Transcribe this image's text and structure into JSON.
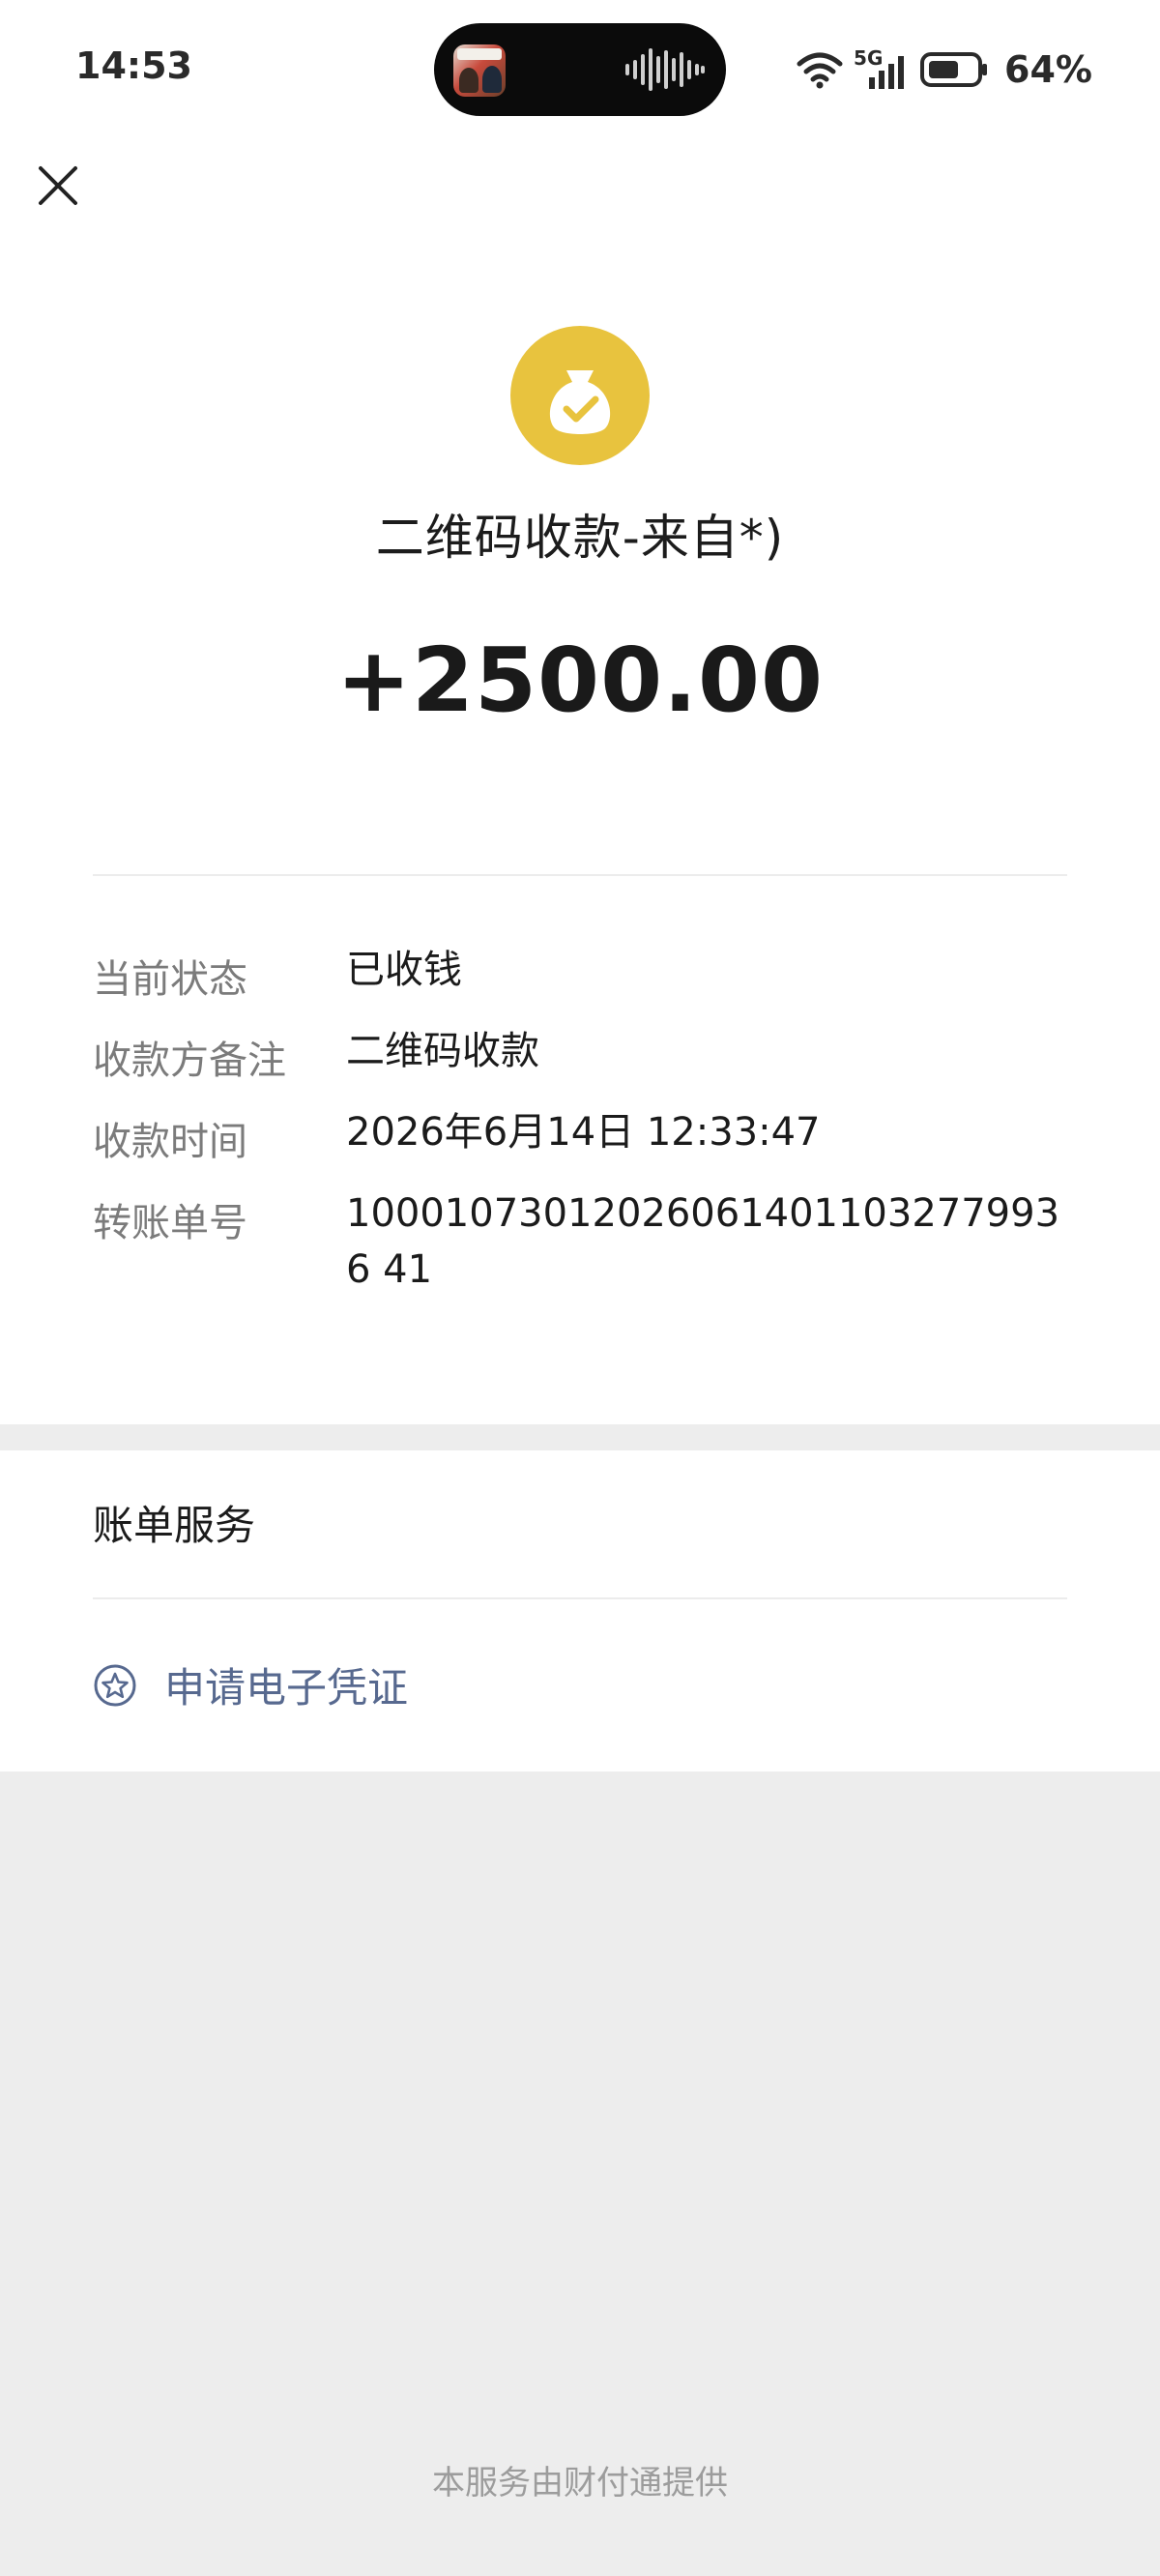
{
  "status_bar": {
    "time": "14:53",
    "network": "5G",
    "battery": "64%"
  },
  "icons": {
    "close": "close-icon",
    "coin": "money-bag-check-icon",
    "voucher": "star-circle-icon"
  },
  "header": {
    "title": "二维码收款-来自*)",
    "amount": "+2500.00"
  },
  "details": [
    {
      "label": "当前状态",
      "value": "已收钱"
    },
    {
      "label": "收款方备注",
      "value": "二维码收款"
    },
    {
      "label": "收款时间",
      "value": "2026年6月14日 12:33:47"
    },
    {
      "label": "转账单号",
      "value": "100010730120260614011032779936 41"
    }
  ],
  "services": {
    "title": "账单服务",
    "apply_voucher": "申请电子凭证"
  },
  "footer": "本服务由财付通提供",
  "colors": {
    "coin": "#e8c33e",
    "link": "#57698f",
    "page_bg": "#ededed"
  }
}
